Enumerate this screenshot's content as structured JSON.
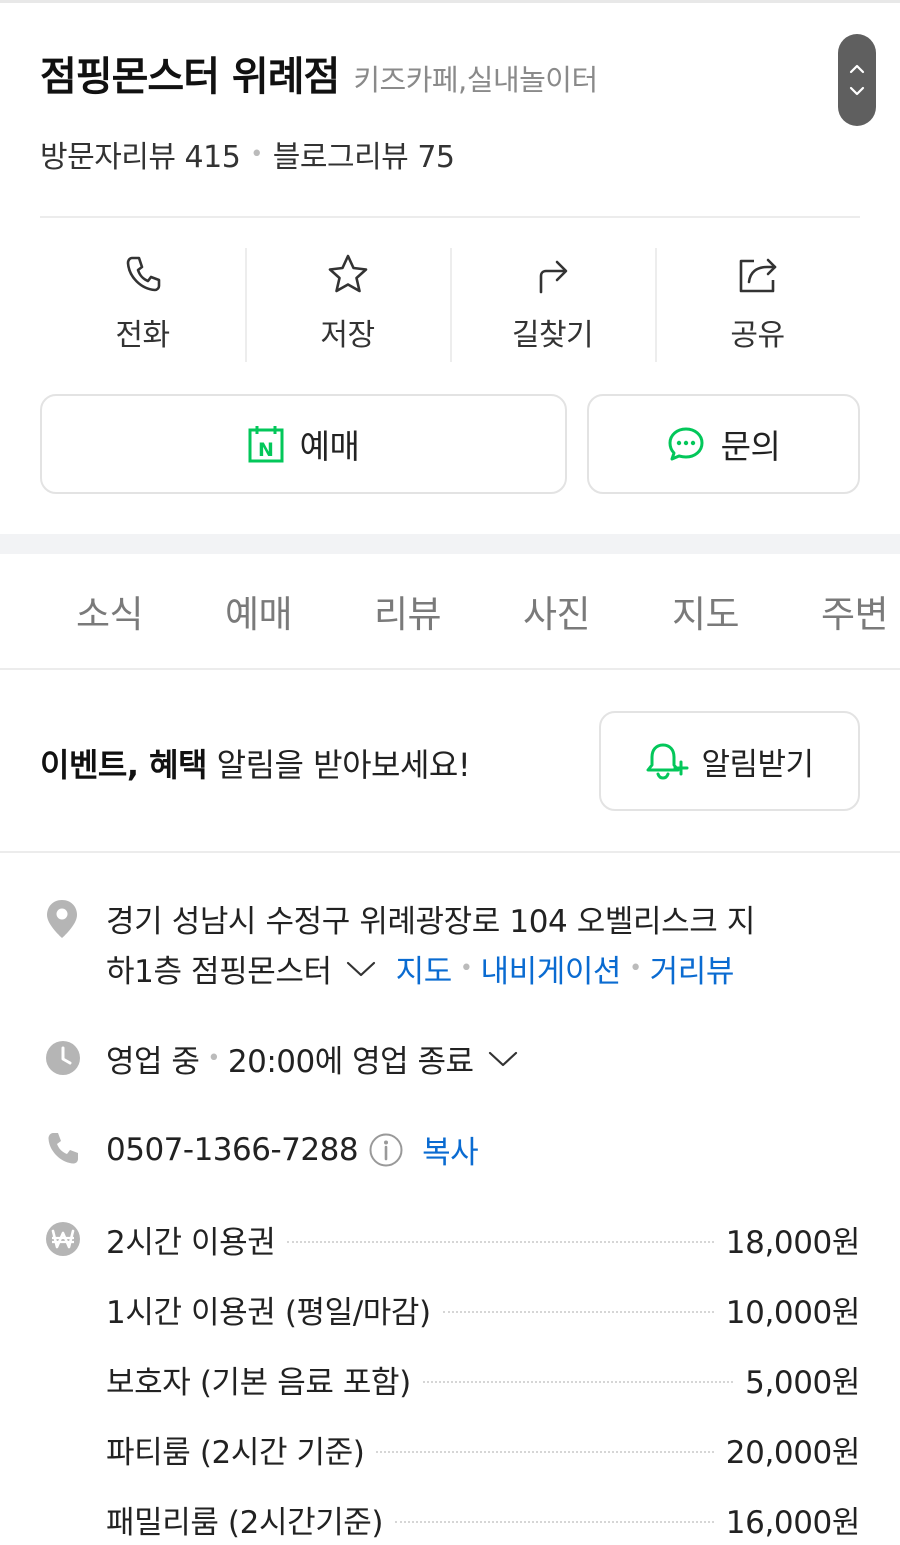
{
  "header": {
    "place_name": "점핑몬스터 위례점",
    "category": "키즈카페,실내놀이터",
    "visitor_reviews": "방문자리뷰 415",
    "blog_reviews": "블로그리뷰 75"
  },
  "actions": [
    {
      "label": "전화",
      "icon": "phone-icon"
    },
    {
      "label": "저장",
      "icon": "star-icon"
    },
    {
      "label": "길찾기",
      "icon": "directions-icon"
    },
    {
      "label": "공유",
      "icon": "share-icon"
    }
  ],
  "buttons": {
    "reserve_label": "예매",
    "inquiry_label": "문의"
  },
  "tabs": [
    "소식",
    "예매",
    "리뷰",
    "사진",
    "지도",
    "주변"
  ],
  "event": {
    "bold_text": "이벤트, 혜택",
    "text": " 알림을 받아보세요!",
    "alert_button": "알림받기"
  },
  "info": {
    "address_line1": "경기 성남시 수정구 위례광장로 104 오벨리스크 지",
    "address_line2": "하1층 점핑몬스터",
    "map_link": "지도",
    "navigation_link": "내비게이션",
    "streetview_link": "거리뷰",
    "status": "영업 중",
    "hours": "20:00에 영업 종료",
    "phone": "0507-1366-7288",
    "copy_link": "복사"
  },
  "prices": [
    {
      "name": "2시간 이용권",
      "amount": "18,000원"
    },
    {
      "name": "1시간 이용권 (평일/마감)",
      "amount": "10,000원"
    },
    {
      "name": "보호자 (기본 음료 포함)",
      "amount": "5,000원"
    },
    {
      "name": "파티룸 (2시간 기준)",
      "amount": "20,000원"
    },
    {
      "name": "패밀리룸 (2시간기준)",
      "amount": "16,000원"
    }
  ],
  "colors": {
    "accent_green": "#03c75a",
    "link_blue": "#0a6bd1",
    "icon_grey": "#b5b5b5"
  }
}
